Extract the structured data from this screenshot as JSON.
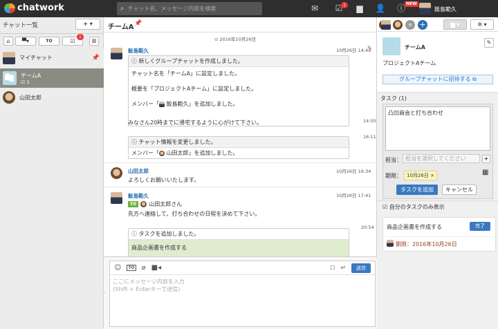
{
  "header": {
    "logo": "chatwork",
    "search_placeholder": "チャット名、メッセージ内容を検索",
    "task_badge": "1",
    "new_badge": "NEW",
    "user_name": "飯島範久"
  },
  "left": {
    "title": "チャット一覧",
    "add": "+",
    "sort": "▾",
    "filter_badge": "1",
    "items": [
      {
        "label": "マイチャット"
      },
      {
        "label": "チームA",
        "sub": "1"
      },
      {
        "label": "山田太郎"
      }
    ]
  },
  "room": {
    "title": "チームA"
  },
  "messages": {
    "date": "2016年10月26日",
    "m1": {
      "name": "飯島範久",
      "time": "10月26日 14:49",
      "head": "新しくグループチャットを作成しました。",
      "l1": "チャット名を「チームA」に設定しました。",
      "l2": "概要を「プロジェクトAチーム」に設定しました。",
      "l3a": "メンバー「",
      "l3b": "飯島範久",
      "l3c": "」を追加しました。"
    },
    "m2": {
      "text": "みなさん20時までに帰宅するように心がけて下さい。",
      "time": "14:50"
    },
    "m3": {
      "time": "16:11",
      "head": "チャット情報を変更しました。",
      "la": "メンバー「",
      "lb": "山田太郎",
      "lc": "」を追加しました。"
    },
    "m4": {
      "name": "山田太郎",
      "time": "10月26日 16:34",
      "text": "よろしくお願いいたします。"
    },
    "m5": {
      "name": "飯島範久",
      "time": "10月26日 17:41",
      "to": "TO",
      "to_name": "山田太郎さん",
      "text": "先方へ連絡して、打ち合わせの日程を決めて下さい。"
    },
    "m6": {
      "time": "20:54",
      "head": "タスクを追加しました。",
      "task": "商品企画書を作成する"
    }
  },
  "composer": {
    "to": "TO",
    "send": "送信",
    "placeholder": "ここにメッセージ内容を入力",
    "hint": "(Shift + Enterキーで送信)"
  },
  "right": {
    "room_name": "チームA",
    "desc": "プロジェクトAチーム",
    "invite": "グループチャットに招待する",
    "tasks_title": "タスク (1)",
    "task_input": "凸凹商会と打ち合わせ",
    "assignee_label": "担当：",
    "assignee_ph": "担当を選択してください",
    "due_label": "期限：",
    "due_value": "10月26日",
    "add_task": "タスクを追加",
    "cancel": "キャンセル",
    "mine_only": "自分のタスクのみ表示",
    "task_item": "商品企画書を作成する",
    "done": "完了",
    "due_text": "期限：2016年10月26日"
  }
}
